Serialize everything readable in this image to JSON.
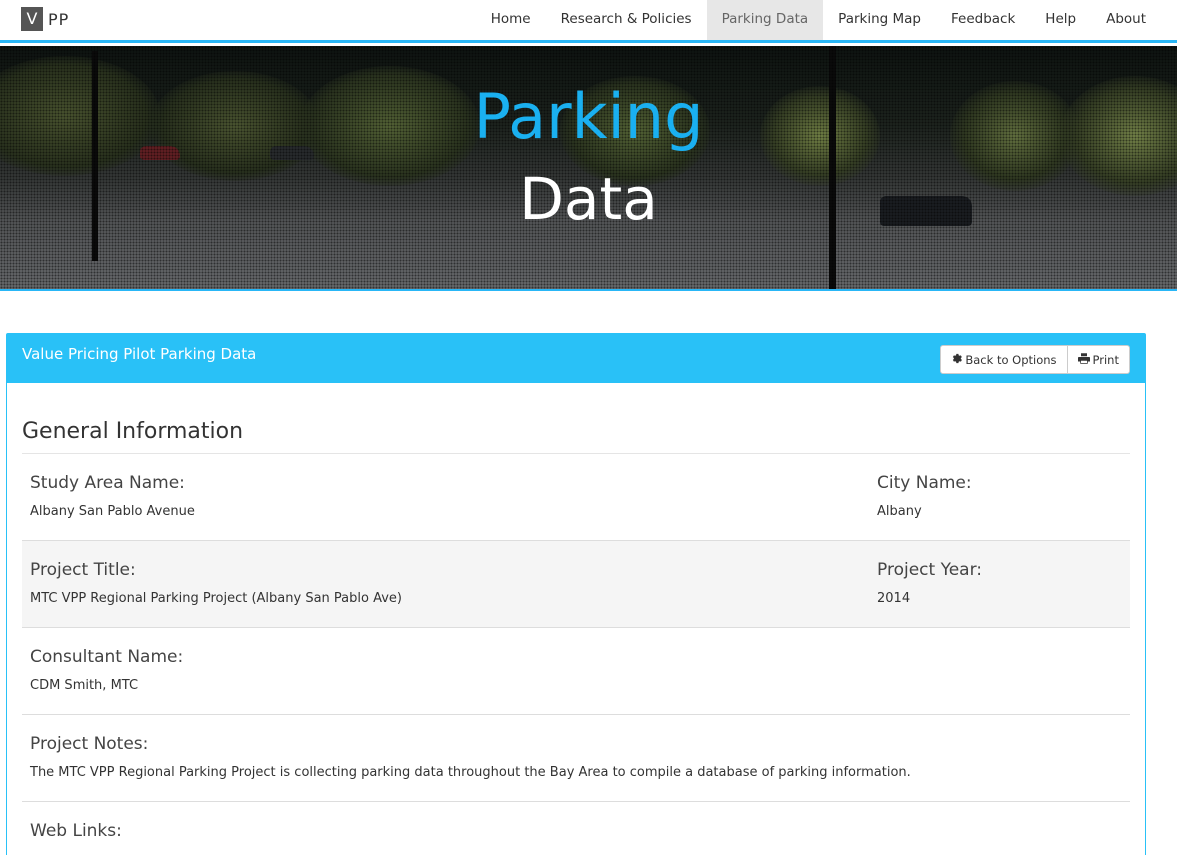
{
  "brand": {
    "box_letter": "V",
    "text": "PP"
  },
  "nav": {
    "items": [
      {
        "label": "Home"
      },
      {
        "label": "Research & Policies"
      },
      {
        "label": "Parking Data"
      },
      {
        "label": "Parking Map"
      },
      {
        "label": "Feedback"
      },
      {
        "label": "Help"
      },
      {
        "label": "About"
      }
    ],
    "active": "Parking Data"
  },
  "hero": {
    "line1": "Parking",
    "line2": "Data"
  },
  "panel": {
    "title": "Value Pricing Pilot Parking Data",
    "buttons": {
      "back": "Back to Options",
      "print": "Print"
    }
  },
  "general": {
    "heading": "General Information",
    "study_area_label": "Study Area Name:",
    "study_area_value": "Albany San Pablo Avenue",
    "city_label": "City Name:",
    "city_value": "Albany",
    "project_title_label": "Project Title:",
    "project_title_value": "MTC VPP Regional Parking Project (Albany San Pablo Ave)",
    "project_year_label": "Project Year:",
    "project_year_value": "2014",
    "consultant_label": "Consultant Name:",
    "consultant_value": "CDM Smith, MTC",
    "notes_label": "Project Notes:",
    "notes_value": "The MTC VPP Regional Parking Project is collecting parking data throughout the Bay Area to compile a database of parking information.",
    "links_label": "Web Links:"
  },
  "colors": {
    "accent": "#29c1f7",
    "hero_title": "#1ab0f0"
  },
  "icons": {
    "back": "gear-icon",
    "print": "print-icon"
  }
}
